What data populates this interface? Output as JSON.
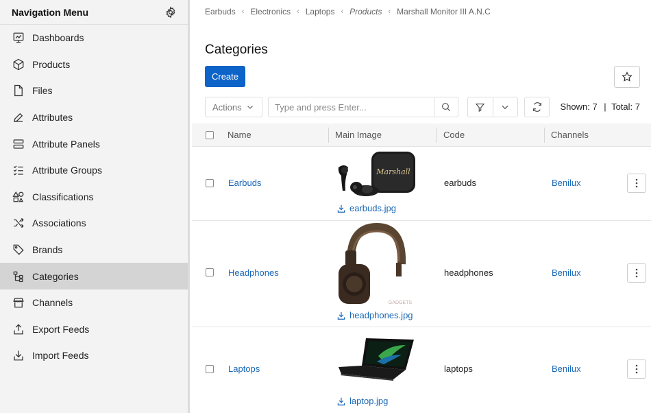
{
  "sidebar": {
    "title": "Navigation Menu",
    "items": [
      {
        "label": "Dashboards",
        "icon": "dashboard-icon"
      },
      {
        "label": "Products",
        "icon": "cube-icon"
      },
      {
        "label": "Files",
        "icon": "file-icon"
      },
      {
        "label": "Attributes",
        "icon": "pencil-icon"
      },
      {
        "label": "Attribute Panels",
        "icon": "panels-icon"
      },
      {
        "label": "Attribute Groups",
        "icon": "checklist-icon"
      },
      {
        "label": "Classifications",
        "icon": "shapes-icon"
      },
      {
        "label": "Associations",
        "icon": "shuffle-icon"
      },
      {
        "label": "Brands",
        "icon": "tag-icon"
      },
      {
        "label": "Categories",
        "icon": "tree-icon",
        "active": true
      },
      {
        "label": "Channels",
        "icon": "store-icon"
      },
      {
        "label": "Export Feeds",
        "icon": "upload-icon"
      },
      {
        "label": "Import Feeds",
        "icon": "download-icon"
      }
    ]
  },
  "breadcrumb": [
    "Earbuds",
    "Electronics",
    "Laptops",
    "Products",
    "Marshall Monitor III A.N.C"
  ],
  "page": {
    "title": "Categories",
    "create_label": "Create"
  },
  "toolbar": {
    "actions_label": "Actions",
    "search_placeholder": "Type and press Enter...",
    "shown_label": "Shown: 7",
    "total_label": "Total: 7",
    "count_separator": "|"
  },
  "table": {
    "columns": [
      "Name",
      "Main Image",
      "Code",
      "Channels"
    ],
    "rows": [
      {
        "name": "Earbuds",
        "image": "earbuds.jpg",
        "code": "earbuds",
        "channel": "Benilux"
      },
      {
        "name": "Headphones",
        "image": "headphones.jpg",
        "code": "headphones",
        "channel": "Benilux"
      },
      {
        "name": "Laptops",
        "image": "laptop.jpg",
        "code": "laptops",
        "channel": "Benilux"
      }
    ]
  },
  "images": {
    "earbuds_brand": "Marshall",
    "headphones_mark": "GADGETS"
  },
  "colors": {
    "primary": "#0d63c7",
    "link": "#1a67b5",
    "sidebar_bg": "#f3f3f3",
    "sidebar_active": "#d4d4d4"
  }
}
